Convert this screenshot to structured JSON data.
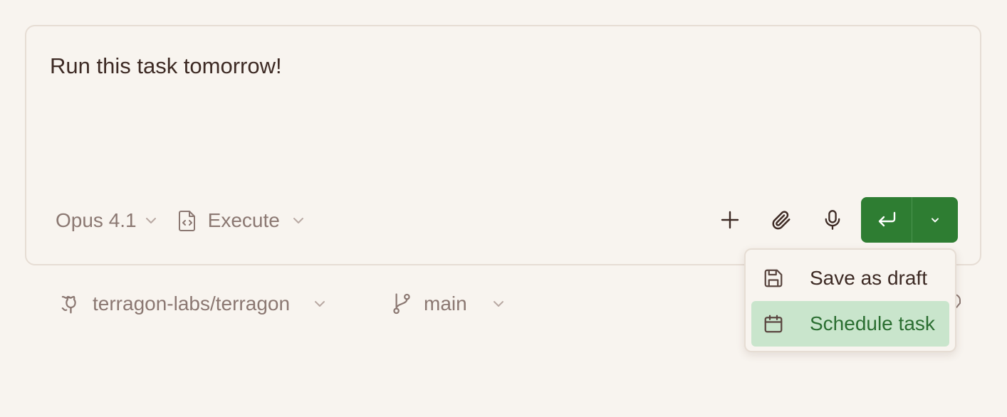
{
  "composer": {
    "prompt_text": "Run this task tomorrow!",
    "model": {
      "label": "Opus 4.1",
      "icon": "chevron-down-icon"
    },
    "mode": {
      "label": "Execute",
      "icon": "file-code-icon"
    },
    "actions": [
      "plus-icon",
      "paperclip-icon",
      "microphone-icon"
    ],
    "send": {
      "icon": "enter-icon",
      "more_icon": "chevron-down-icon",
      "color": "#2e7d32"
    }
  },
  "context": {
    "repo": {
      "label": "terragon-labs/terragon",
      "icon": "github-icon"
    },
    "branch": {
      "label": "main",
      "icon": "git-branch-icon"
    }
  },
  "send_menu": {
    "items": [
      {
        "label": "Save as draft",
        "icon": "save-icon",
        "active": false
      },
      {
        "label": "Schedule task",
        "icon": "calendar-icon",
        "active": true
      }
    ],
    "active_bg": "#c9e5cc",
    "active_text": "#2b6e31"
  }
}
